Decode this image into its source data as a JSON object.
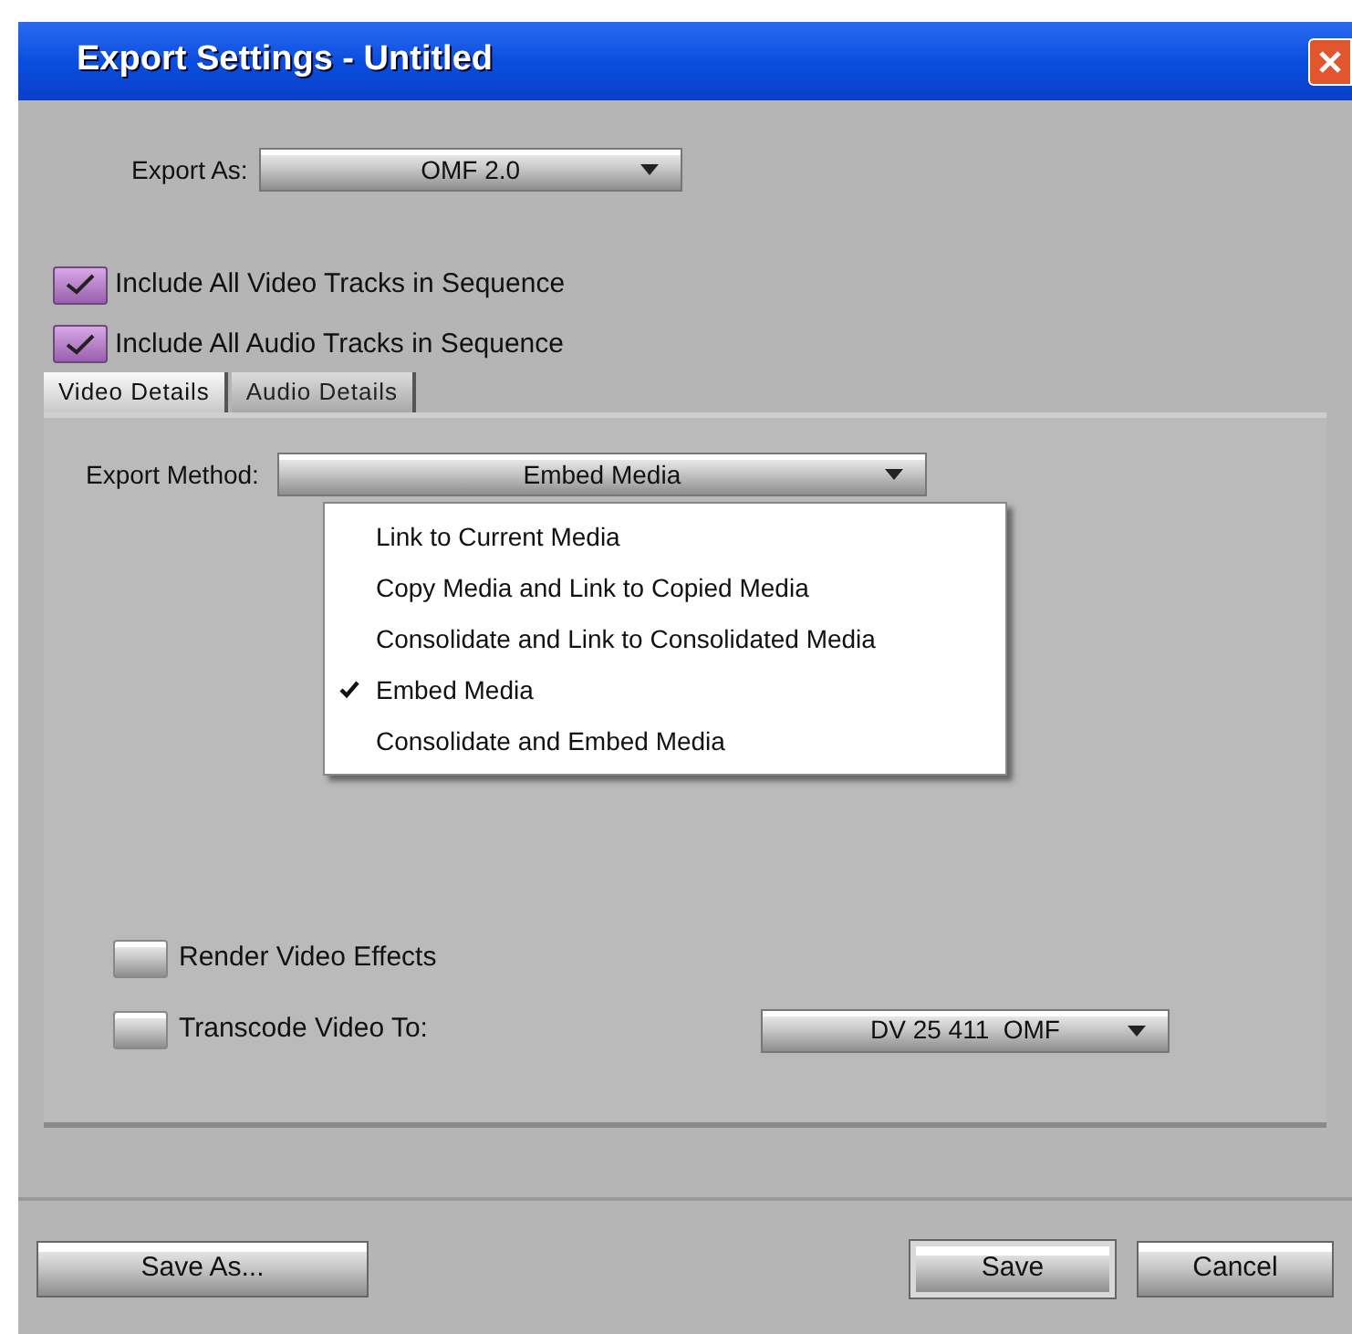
{
  "window": {
    "title": "Export Settings - Untitled"
  },
  "export_as": {
    "label": "Export As:",
    "value": "OMF 2.0"
  },
  "options": [
    {
      "label": "Include All Video Tracks in Sequence",
      "checked": true
    },
    {
      "label": "Include All Audio Tracks in Sequence",
      "checked": true
    }
  ],
  "tabs": [
    {
      "label": "Video Details",
      "selected": true
    },
    {
      "label": "Audio Details",
      "selected": false
    }
  ],
  "export_method": {
    "label": "Export Method:",
    "value": "Embed Media",
    "menu": [
      {
        "label": "Link to Current Media",
        "selected": false
      },
      {
        "label": "Copy Media and Link to Copied Media",
        "selected": false
      },
      {
        "label": "Consolidate and Link to Consolidated Media",
        "selected": false
      },
      {
        "label": "Embed Media",
        "selected": true
      },
      {
        "label": "Consolidate and Embed Media",
        "selected": false
      }
    ]
  },
  "video_options": [
    {
      "label": "Render Video Effects",
      "checked": false
    },
    {
      "label": "Transcode Video To:",
      "checked": false
    }
  ],
  "transcode": {
    "value": "DV 25 411  OMF"
  },
  "buttons": [
    {
      "label": "Save As...",
      "default": false
    },
    {
      "label": "Save",
      "default": true
    },
    {
      "label": "Cancel",
      "default": false
    }
  ]
}
